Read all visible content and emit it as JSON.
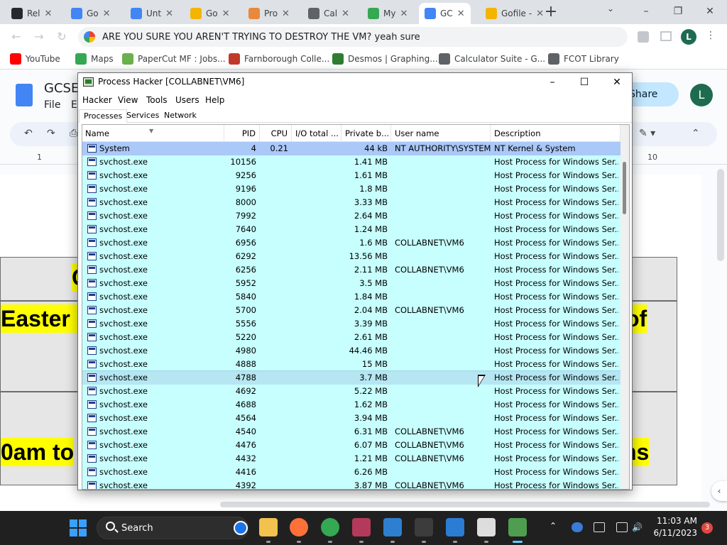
{
  "browser": {
    "tabs": [
      {
        "title": "Rel",
        "color": "#24292f"
      },
      {
        "title": "Go",
        "color": "#4285f4"
      },
      {
        "title": "Unt",
        "color": "#4285f4"
      },
      {
        "title": "Go",
        "color": "#f4b400"
      },
      {
        "title": "Pro",
        "color": "#e8893c"
      },
      {
        "title": "Cal",
        "color": "#5f6368"
      },
      {
        "title": "My",
        "color": "#34a853"
      },
      {
        "title": "GC",
        "color": "#4285f4"
      },
      {
        "title": "Gofile -",
        "color": "#f4b400"
      }
    ],
    "omnibox_text": "ARE YOU SURE YOU AREN'T TRYING TO DESTROY THE VM? yeah sure",
    "profile_initial": "L",
    "bookmarks": [
      {
        "label": "YouTube",
        "color": "#ff0000"
      },
      {
        "label": "Maps",
        "color": "#34a853"
      },
      {
        "label": "PaperCut MF : Jobs...",
        "color": "#6ab04c"
      },
      {
        "label": "Farnborough Colle...",
        "color": "#c0392b"
      },
      {
        "label": "Desmos | Graphing...",
        "color": "#2e7d32"
      },
      {
        "label": "Calculator Suite - G...",
        "color": "#5f6368"
      },
      {
        "label": "FCOT Library",
        "color": "#5f6368"
      }
    ]
  },
  "docs": {
    "title": "GCSE",
    "menu_file": "File",
    "menu_edit": "E",
    "share_label": "Share",
    "avatar_initial": "L",
    "ruler_left": "1",
    "ruler_right": "10",
    "highlight_1": "Easter H",
    "highlight_1_end": "of",
    "highlight_2": "0am to",
    "highlight_2_end": "ns",
    "highlight_top": "C"
  },
  "process_hacker": {
    "window_title": "Process Hacker [COLLABNET\\VM6]",
    "menu": [
      "Hacker",
      "View",
      "Tools",
      "Users",
      "Help"
    ],
    "tabs": [
      "Processes",
      "Services",
      "Network"
    ],
    "columns": [
      "Name",
      "PID",
      "CPU",
      "I/O total ...",
      "Private b...",
      "User name",
      "Description"
    ],
    "rows": [
      {
        "name": "System",
        "pid": "4",
        "cpu": "0.21",
        "io": "",
        "private": "44 kB",
        "user": "NT AUTHORITY\\SYSTEM",
        "desc": "NT Kernel & System",
        "state": "sys"
      },
      {
        "name": "svchost.exe",
        "pid": "10156",
        "cpu": "",
        "io": "",
        "private": "1.41 MB",
        "user": "",
        "desc": "Host Process for Windows Ser...",
        "state": ""
      },
      {
        "name": "svchost.exe",
        "pid": "9256",
        "cpu": "",
        "io": "",
        "private": "1.61 MB",
        "user": "",
        "desc": "Host Process for Windows Ser...",
        "state": ""
      },
      {
        "name": "svchost.exe",
        "pid": "9196",
        "cpu": "",
        "io": "",
        "private": "1.8 MB",
        "user": "",
        "desc": "Host Process for Windows Ser...",
        "state": ""
      },
      {
        "name": "svchost.exe",
        "pid": "8000",
        "cpu": "",
        "io": "",
        "private": "3.33 MB",
        "user": "",
        "desc": "Host Process for Windows Ser...",
        "state": ""
      },
      {
        "name": "svchost.exe",
        "pid": "7992",
        "cpu": "",
        "io": "",
        "private": "2.64 MB",
        "user": "",
        "desc": "Host Process for Windows Ser...",
        "state": ""
      },
      {
        "name": "svchost.exe",
        "pid": "7640",
        "cpu": "",
        "io": "",
        "private": "1.24 MB",
        "user": "",
        "desc": "Host Process for Windows Ser...",
        "state": ""
      },
      {
        "name": "svchost.exe",
        "pid": "6956",
        "cpu": "",
        "io": "",
        "private": "1.6 MB",
        "user": "COLLABNET\\VM6",
        "desc": "Host Process for Windows Ser...",
        "state": ""
      },
      {
        "name": "svchost.exe",
        "pid": "6292",
        "cpu": "",
        "io": "",
        "private": "13.56 MB",
        "user": "",
        "desc": "Host Process for Windows Ser...",
        "state": ""
      },
      {
        "name": "svchost.exe",
        "pid": "6256",
        "cpu": "",
        "io": "",
        "private": "2.11 MB",
        "user": "COLLABNET\\VM6",
        "desc": "Host Process for Windows Ser...",
        "state": ""
      },
      {
        "name": "svchost.exe",
        "pid": "5952",
        "cpu": "",
        "io": "",
        "private": "3.5 MB",
        "user": "",
        "desc": "Host Process for Windows Ser...",
        "state": ""
      },
      {
        "name": "svchost.exe",
        "pid": "5840",
        "cpu": "",
        "io": "",
        "private": "1.84 MB",
        "user": "",
        "desc": "Host Process for Windows Ser...",
        "state": ""
      },
      {
        "name": "svchost.exe",
        "pid": "5700",
        "cpu": "",
        "io": "",
        "private": "2.04 MB",
        "user": "COLLABNET\\VM6",
        "desc": "Host Process for Windows Ser...",
        "state": ""
      },
      {
        "name": "svchost.exe",
        "pid": "5556",
        "cpu": "",
        "io": "",
        "private": "3.39 MB",
        "user": "",
        "desc": "Host Process for Windows Ser...",
        "state": ""
      },
      {
        "name": "svchost.exe",
        "pid": "5220",
        "cpu": "",
        "io": "",
        "private": "2.61 MB",
        "user": "",
        "desc": "Host Process for Windows Ser...",
        "state": ""
      },
      {
        "name": "svchost.exe",
        "pid": "4980",
        "cpu": "",
        "io": "",
        "private": "44.46 MB",
        "user": "",
        "desc": "Host Process for Windows Ser...",
        "state": ""
      },
      {
        "name": "svchost.exe",
        "pid": "4888",
        "cpu": "",
        "io": "",
        "private": "15 MB",
        "user": "",
        "desc": "Host Process for Windows Ser...",
        "state": ""
      },
      {
        "name": "svchost.exe",
        "pid": "4788",
        "cpu": "",
        "io": "",
        "private": "3.7 MB",
        "user": "",
        "desc": "Host Process for Windows Ser...",
        "state": "sel"
      },
      {
        "name": "svchost.exe",
        "pid": "4692",
        "cpu": "",
        "io": "",
        "private": "5.22 MB",
        "user": "",
        "desc": "Host Process for Windows Ser...",
        "state": ""
      },
      {
        "name": "svchost.exe",
        "pid": "4688",
        "cpu": "",
        "io": "",
        "private": "1.62 MB",
        "user": "",
        "desc": "Host Process for Windows Ser...",
        "state": ""
      },
      {
        "name": "svchost.exe",
        "pid": "4564",
        "cpu": "",
        "io": "",
        "private": "3.94 MB",
        "user": "",
        "desc": "Host Process for Windows Ser...",
        "state": ""
      },
      {
        "name": "svchost.exe",
        "pid": "4540",
        "cpu": "",
        "io": "",
        "private": "6.31 MB",
        "user": "COLLABNET\\VM6",
        "desc": "Host Process for Windows Ser...",
        "state": ""
      },
      {
        "name": "svchost.exe",
        "pid": "4476",
        "cpu": "",
        "io": "",
        "private": "6.07 MB",
        "user": "COLLABNET\\VM6",
        "desc": "Host Process for Windows Ser...",
        "state": ""
      },
      {
        "name": "svchost.exe",
        "pid": "4432",
        "cpu": "",
        "io": "",
        "private": "1.21 MB",
        "user": "COLLABNET\\VM6",
        "desc": "Host Process for Windows Ser...",
        "state": ""
      },
      {
        "name": "svchost.exe",
        "pid": "4416",
        "cpu": "",
        "io": "",
        "private": "6.26 MB",
        "user": "",
        "desc": "Host Process for Windows Ser...",
        "state": ""
      },
      {
        "name": "svchost.exe",
        "pid": "4392",
        "cpu": "",
        "io": "",
        "private": "3.87 MB",
        "user": "COLLABNET\\VM6",
        "desc": "Host Process for Windows Ser...",
        "state": ""
      }
    ]
  },
  "taskbar": {
    "search_label": "Search",
    "time": "11:03 AM",
    "date": "6/11/2023",
    "notification_count": "3",
    "apps": [
      {
        "name": "file-explorer-icon",
        "color": "#f2c14e"
      },
      {
        "name": "firefox-icon",
        "color": "#ff7139"
      },
      {
        "name": "chrome-icon",
        "color": "#34a853"
      },
      {
        "name": "media-app-icon",
        "color": "#b33a5a"
      },
      {
        "name": "paint-app-icon",
        "color": "#2f7fd1"
      },
      {
        "name": "terminal-icon",
        "color": "#3c3c3c"
      },
      {
        "name": "window-app-icon",
        "color": "#2b7cd3"
      },
      {
        "name": "7zip-icon",
        "color": "#dddddd"
      },
      {
        "name": "process-hacker-icon",
        "color": "#4f9d4f"
      }
    ]
  }
}
